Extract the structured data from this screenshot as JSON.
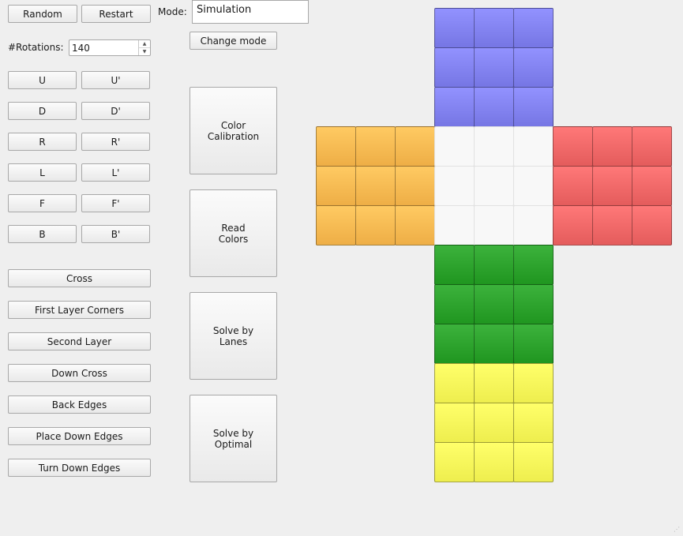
{
  "controls": {
    "random_label": "Random",
    "restart_label": "Restart",
    "rotations_label": "#Rotations:",
    "rotations_value": "140",
    "mode_label": "Mode:",
    "mode_value": "Simulation",
    "change_mode_label": "Change mode"
  },
  "moves": [
    {
      "name": "U",
      "inverse": "U'"
    },
    {
      "name": "D",
      "inverse": "D'"
    },
    {
      "name": "R",
      "inverse": "R'"
    },
    {
      "name": "L",
      "inverse": "L'"
    },
    {
      "name": "F",
      "inverse": "F'"
    },
    {
      "name": "B",
      "inverse": "B'"
    }
  ],
  "steps": [
    "Cross",
    "First Layer Corners",
    "Second Layer",
    "Down Cross",
    "Back Edges",
    "Place Down Edges",
    "Turn Down Edges"
  ],
  "big_buttons": [
    "Color\nCalibration",
    "Read\nColors",
    "Solve by\nLanes",
    "Solve by\nOptimal"
  ],
  "cube": {
    "colors": {
      "blue": "#8080ee",
      "orange": "#f8b850",
      "white": "#f8f8f8",
      "red": "#ee6666",
      "green": "#2aa02a",
      "yellow": "#f8f858"
    },
    "faces": [
      {
        "name": "top",
        "color": "blue"
      },
      {
        "name": "left",
        "color": "orange"
      },
      {
        "name": "center",
        "color": "white"
      },
      {
        "name": "right",
        "color": "red"
      },
      {
        "name": "bottom",
        "color": "green"
      },
      {
        "name": "back",
        "color": "yellow"
      }
    ]
  }
}
